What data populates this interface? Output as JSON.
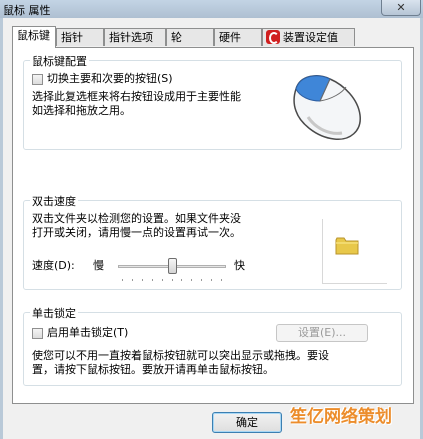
{
  "window": {
    "title": "鼠标 属性",
    "close_label": "✕"
  },
  "tabs": [
    {
      "label": "鼠标键"
    },
    {
      "label": "指针"
    },
    {
      "label": "指针选项"
    },
    {
      "label": "轮"
    },
    {
      "label": "硬件"
    },
    {
      "label": "装置设定值"
    }
  ],
  "button_config": {
    "title": "鼠标键配置",
    "checkbox_label": "切换主要和次要的按钮(S)",
    "checked": false,
    "description_line1": "选择此复选框来将右按钮设成用于主要性能",
    "description_line2": "如选择和拖放之用。"
  },
  "double_click": {
    "title": "双击速度",
    "description_line1": "双击文件夹以检测您的设置。如果文件夹没",
    "description_line2": "打开或关闭，请用慢一点的设置再试一次。",
    "speed_label": "速度(D):",
    "slow_label": "慢",
    "fast_label": "快",
    "speed_level": 0.5
  },
  "click_lock": {
    "title": "单击锁定",
    "checkbox_label": "启用单击锁定(T)",
    "checked": false,
    "settings_button": "设置(E)...",
    "description_line1": "使您可以不用一直按着鼠标按钮就可以突出显示或拖拽。要设",
    "description_line2": "置，请按下鼠标按钮。要放开请再单击鼠标按钮。"
  },
  "footer": {
    "ok_label": "确定"
  },
  "watermark": {
    "text": "笙亿网络策划"
  }
}
